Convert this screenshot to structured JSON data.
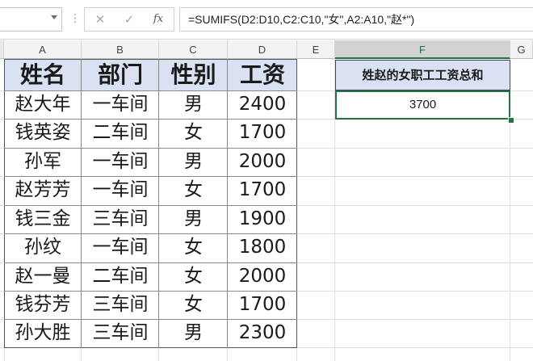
{
  "formula_bar": {
    "name_box": "",
    "cancel_glyph": "✕",
    "confirm_glyph": "✓",
    "fx_label": "fx",
    "formula": "=SUMIFS(D2:D10,C2:C10,\"女\",A2:A10,\"赵*\")"
  },
  "columns": [
    "A",
    "B",
    "C",
    "D",
    "E",
    "F",
    "G"
  ],
  "selected_column": "F",
  "table": {
    "headers": [
      "姓名",
      "部门",
      "性别",
      "工资"
    ],
    "rows": [
      [
        "赵大年",
        "一车间",
        "男",
        "2400"
      ],
      [
        "钱英姿",
        "二车间",
        "女",
        "1700"
      ],
      [
        "孙军",
        "一车间",
        "男",
        "2000"
      ],
      [
        "赵芳芳",
        "一车间",
        "女",
        "1700"
      ],
      [
        "钱三金",
        "三车间",
        "男",
        "1900"
      ],
      [
        "孙纹",
        "一车间",
        "女",
        "1800"
      ],
      [
        "赵一曼",
        "二车间",
        "女",
        "2000"
      ],
      [
        "钱芬芳",
        "三车间",
        "女",
        "1700"
      ],
      [
        "孙大胜",
        "三车间",
        "男",
        "2300"
      ]
    ]
  },
  "result": {
    "title": "姓赵的女职工工资总和",
    "value": "3700"
  },
  "colors": {
    "header_fill": "#d9e1f2",
    "selection_green": "#217346"
  }
}
